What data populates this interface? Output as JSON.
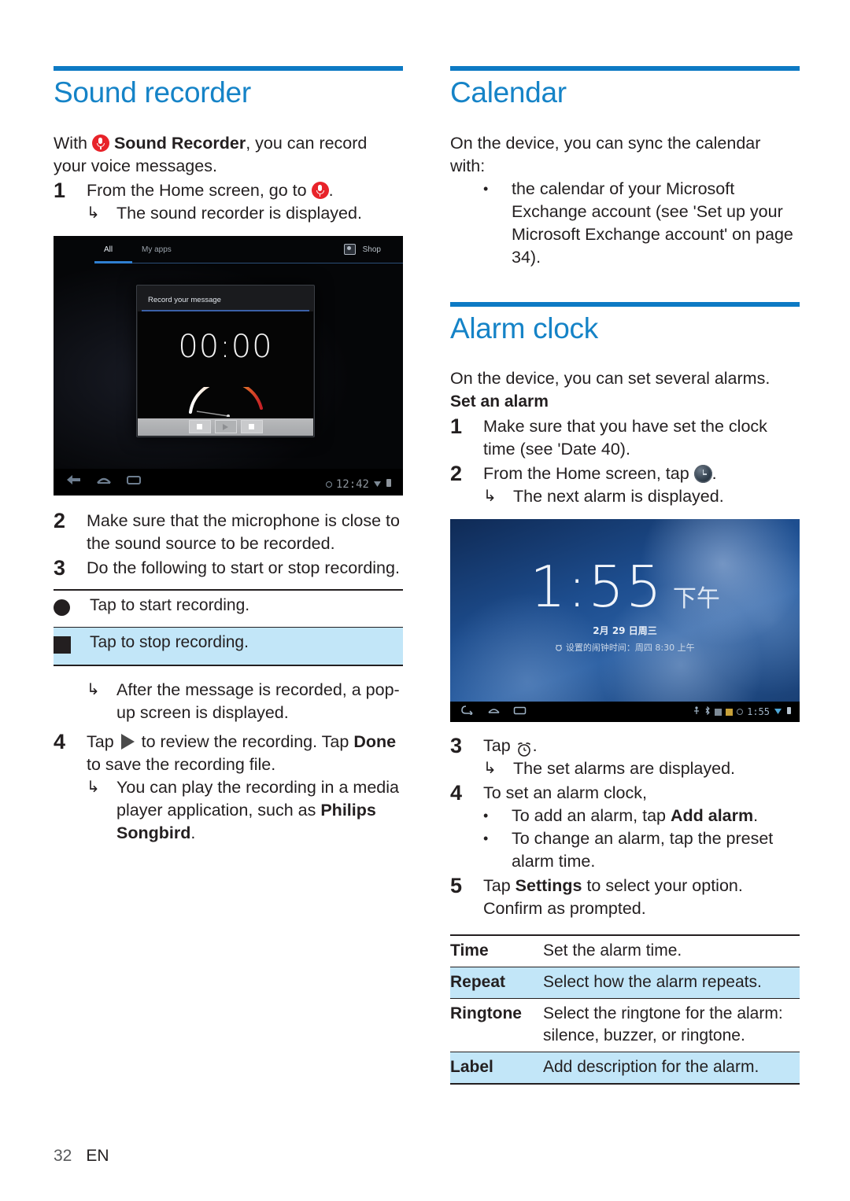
{
  "colors": {
    "heading_blue": "#1583c7",
    "rule_blue": "#0d7ac4",
    "row_highlight": "#c2e6f8",
    "mic_red": "#e8232a",
    "text": "#231f20"
  },
  "left_column": {
    "section_title": "Sound recorder",
    "intro": {
      "before_icon": "With ",
      "icon": "sound-recorder-mic-icon",
      "bold_part": "Sound Recorder",
      "after": ", you can record your voice messages."
    },
    "step1": {
      "number": "1",
      "text_before_icon": "From the Home screen, go to ",
      "icon": "sound-recorder-mic-icon",
      "text_after_icon": ".",
      "result_arrow": "↳",
      "result": "The sound recorder is displayed."
    },
    "screenshot": {
      "name": "sound-recorder-screenshot",
      "tab_all": "All",
      "tab_my_apps": "My apps",
      "shop_label": "Shop",
      "shop_icon": "shop-bag-icon",
      "dialog_title": "Record your message",
      "timer": "00:00",
      "buttons": [
        "record-button",
        "play-button",
        "stop-button"
      ],
      "nav_icons": [
        "back-icon",
        "home-icon",
        "recents-icon"
      ],
      "status_time": "12:42"
    },
    "step2": {
      "number": "2",
      "text": "Make sure that the microphone is close to the sound source to be recorded."
    },
    "step3": {
      "number": "3",
      "text": "Do the following to start or stop recording."
    },
    "action_table": {
      "rows": [
        {
          "icon": "record-circle-icon",
          "text": "Tap to start recording.",
          "highlighted": false
        },
        {
          "icon": "stop-square-icon",
          "text": "Tap to stop recording.",
          "highlighted": true
        }
      ]
    },
    "step3_result": {
      "arrow": "↳",
      "text": "After the message is recorded, a pop-up screen is displayed."
    },
    "step4": {
      "number": "4",
      "text_before_icon": "Tap ",
      "icon": "play-triangle-icon",
      "text_mid": " to review the recording. Tap ",
      "bold_done": "Done",
      "text_after": " to save the recording file.",
      "result_arrow": "↳",
      "result_before_bold": "You can play the recording in a media player application, such as ",
      "result_bold": "Philips Songbird",
      "result_after_bold": "."
    }
  },
  "right_column": {
    "calendar": {
      "section_title": "Calendar",
      "intro": "On the device, you can sync the calendar with:",
      "bullet": "the calendar of your Microsoft Exchange account (see 'Set up your Microsoft Exchange account' on page 34)."
    },
    "alarm": {
      "section_title": "Alarm clock",
      "intro": "On the device, you can set several alarms.",
      "sub_head": "Set an alarm",
      "step1": {
        "number": "1",
        "text": "Make sure that you have set the clock time (see 'Date 40)."
      },
      "step2": {
        "number": "2",
        "text_before_icon": "From the Home screen, tap ",
        "icon": "android-clock-icon",
        "text_after_icon": ".",
        "result_arrow": "↳",
        "result": "The next alarm is displayed."
      },
      "screenshot": {
        "name": "alarm-clock-screenshot",
        "time": "1:55",
        "ampm": "下午",
        "date": "2月 29 日周三",
        "alarm_line_icon": "alarm-bell-icon",
        "alarm_line": "设置的闹钟时间：周四 8:30 上午",
        "nav_icons": [
          "back-icon",
          "home-icon",
          "recents-icon"
        ],
        "status_time": "1:55"
      },
      "step3": {
        "number": "3",
        "text_before_icon": "Tap ",
        "icon": "alarm-clock-icon",
        "text_after_icon": ".",
        "result_arrow": "↳",
        "result": "The set alarms are displayed."
      },
      "step4": {
        "number": "4",
        "text": "To set an alarm clock,",
        "bullets": [
          {
            "before_bold": "To add an alarm, tap ",
            "bold": "Add alarm",
            "after_bold": "."
          },
          {
            "before_bold": "To change an alarm, tap the preset alarm time.",
            "bold": "",
            "after_bold": ""
          }
        ]
      },
      "step5": {
        "number": "5",
        "before_bold": "Tap ",
        "bold": "Settings",
        "after_bold": " to select your option. Confirm as prompted."
      },
      "settings_table": {
        "rows": [
          {
            "key": "Time",
            "value": "Set the alarm time.",
            "highlighted": false
          },
          {
            "key": "Repeat",
            "value": "Select how the alarm repeats.",
            "highlighted": true
          },
          {
            "key": "Ringtone",
            "value": "Select the ringtone for the alarm: silence, buzzer, or ringtone.",
            "highlighted": false
          },
          {
            "key": "Label",
            "value": "Add description for the alarm.",
            "highlighted": true
          }
        ]
      }
    }
  },
  "footer": {
    "page_number": "32",
    "language": "EN"
  }
}
